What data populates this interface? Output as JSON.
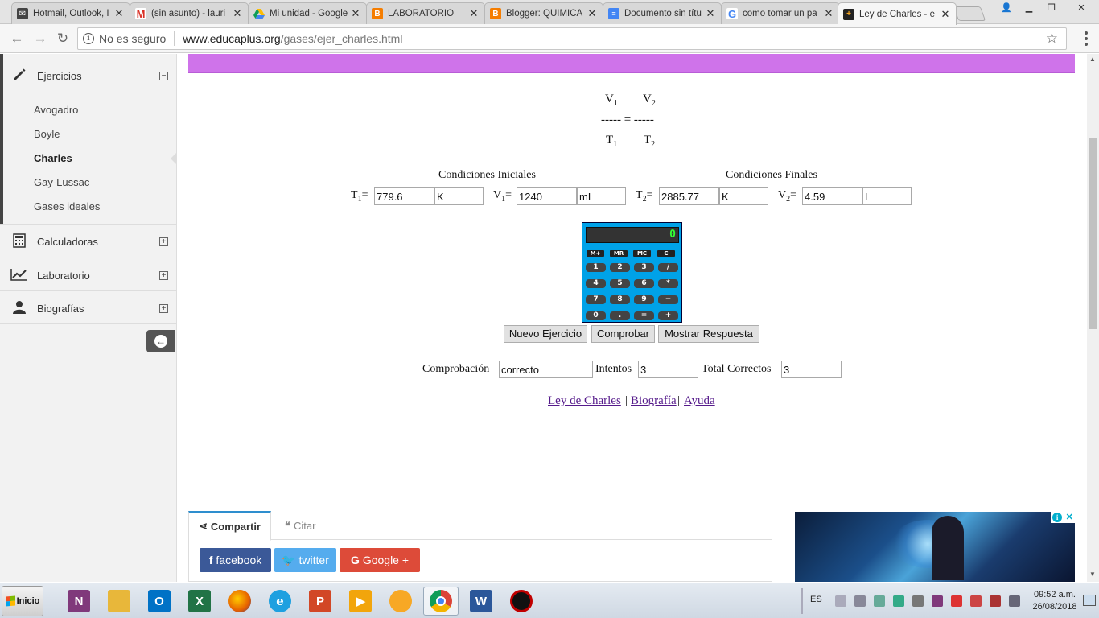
{
  "browser": {
    "tabs": [
      {
        "label": "Hotmail, Outlook, I",
        "icon": "hotmail-icon",
        "color": "#444444"
      },
      {
        "label": "(sin asunto) - lauri",
        "icon": "gmail-icon",
        "color": "#d93025"
      },
      {
        "label": "Mi unidad - Google",
        "icon": "google-drive-icon",
        "color": "#1fa463"
      },
      {
        "label": "LABORATORIO",
        "icon": "blogger-icon",
        "color": "#f57d00"
      },
      {
        "label": "Blogger: QUÍMICA",
        "icon": "blogger-icon",
        "color": "#f57d00"
      },
      {
        "label": "Documento sin títu",
        "icon": "google-docs-icon",
        "color": "#4285f4"
      },
      {
        "label": "como tomar un pa",
        "icon": "google-icon",
        "color": "#4285f4"
      },
      {
        "label": "Ley de Charles - e",
        "icon": "educaplus-icon",
        "color": "#222222"
      }
    ],
    "address": {
      "security": "No es seguro",
      "host": "www.educaplus.org",
      "path": "/gases/ejer_charles.html"
    }
  },
  "sidebar": {
    "sections": [
      {
        "label": "Ejercicios",
        "icon": "pencil-icon",
        "toggle": "⊟"
      },
      {
        "label": "Calculadoras",
        "icon": "calculator-icon",
        "toggle": "⊞"
      },
      {
        "label": "Laboratorio",
        "icon": "line-chart-icon",
        "toggle": "⊞"
      },
      {
        "label": "Biografías",
        "icon": "user-icon",
        "toggle": "⊞"
      }
    ],
    "items": [
      "Avogadro",
      "Boyle",
      "Charles",
      "Gay-Lussac",
      "Gases ideales"
    ],
    "active_item": "Charles"
  },
  "formula": {
    "v": "V",
    "t": "T",
    "sub1": "1",
    "sub2": "2",
    "line": "----- = -----"
  },
  "conditions": {
    "initial_title": "Condiciones Iniciales",
    "final_title": "Condiciones Finales",
    "t_label": "T",
    "v_label": "V",
    "eq": "=",
    "t1": {
      "value": "779.6",
      "unit": "K"
    },
    "v1": {
      "value": "1240",
      "unit": "mL"
    },
    "t2": {
      "value": "2885.77",
      "unit": "K"
    },
    "v2": {
      "value": "4.59",
      "unit": "L"
    }
  },
  "calculator": {
    "display": "0",
    "memory_keys": [
      "M+",
      "MR",
      "MC",
      "C"
    ],
    "keys": [
      "1",
      "2",
      "3",
      "/",
      "4",
      "5",
      "6",
      "*",
      "7",
      "8",
      "9",
      "−",
      "0",
      ".",
      "=",
      "+"
    ]
  },
  "actions": {
    "new_exercise": "Nuevo Ejercicio",
    "check": "Comprobar",
    "show_answer": "Mostrar Respuesta"
  },
  "results": {
    "check_label": "Comprobación",
    "check_value": "correcto",
    "attempts_label": "Intentos",
    "attempts_value": "3",
    "total_label": "Total Correctos",
    "total_value": "3"
  },
  "footer_links": {
    "law": "Ley de Charles",
    "bio": "Biografía",
    "help": "Ayuda",
    "sep": "|"
  },
  "share": {
    "tab_share": "Compartir",
    "tab_cite": "Citar",
    "facebook": "facebook",
    "twitter": "twitter",
    "google": "Google +",
    "facebook_color": "#3b5998",
    "twitter_color": "#55acee",
    "google_color": "#dd4b39"
  },
  "taskbar": {
    "start": "Inicio",
    "language": "ES",
    "time": "09:52 a.m.",
    "date": "26/08/2018",
    "apps": [
      {
        "name": "onenote-icon",
        "color": "#80397b",
        "glyph": "N"
      },
      {
        "name": "file-explorer-icon",
        "color": "#e8b73a",
        "glyph": ""
      },
      {
        "name": "outlook-icon",
        "color": "#0072c6",
        "glyph": "O"
      },
      {
        "name": "excel-icon",
        "color": "#217346",
        "glyph": "X"
      },
      {
        "name": "firefox-icon",
        "color": "#e66000",
        "glyph": ""
      },
      {
        "name": "internet-explorer-icon",
        "color": "#1ea0e0",
        "glyph": "e"
      },
      {
        "name": "powerpoint-icon",
        "color": "#d24726",
        "glyph": "P"
      },
      {
        "name": "media-player-icon",
        "color": "#f2a50c",
        "glyph": "▶"
      },
      {
        "name": "scratch-icon",
        "color": "#f7a825",
        "glyph": ""
      },
      {
        "name": "chrome-icon",
        "color": "#4285f4",
        "glyph": ""
      },
      {
        "name": "word-icon",
        "color": "#2b579a",
        "glyph": "W"
      },
      {
        "name": "app-red-icon",
        "color": "#c00000",
        "glyph": ""
      }
    ]
  }
}
